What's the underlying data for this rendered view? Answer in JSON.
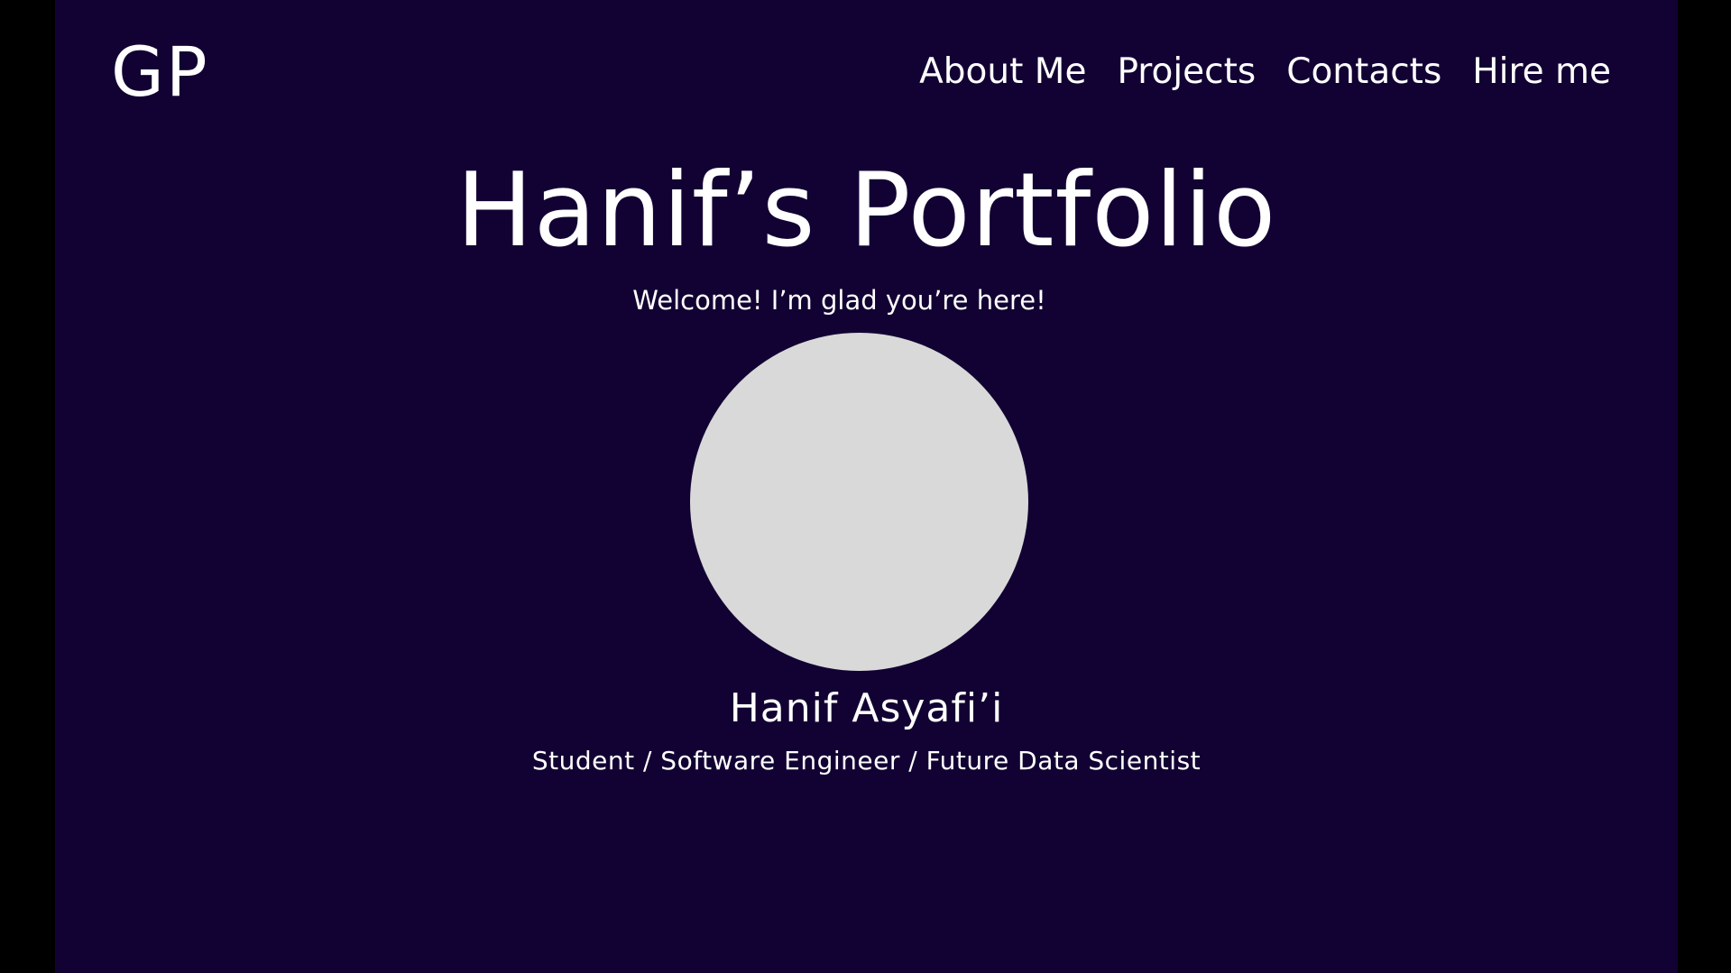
{
  "header": {
    "logo": "GP",
    "nav": [
      {
        "label": "About Me"
      },
      {
        "label": "Projects"
      },
      {
        "label": "Contacts"
      },
      {
        "label": "Hire me"
      }
    ]
  },
  "hero": {
    "title": "Hanif’s Portfolio",
    "welcome": "Welcome! I’m glad you’re here!",
    "name": "Hanif Asyafi’i",
    "roles": "Student / Software Engineer / Future Data Scientist"
  },
  "colors": {
    "background": "#120233",
    "outer": "#000000",
    "text": "#ffffff",
    "avatar": "#d9d9d9"
  }
}
